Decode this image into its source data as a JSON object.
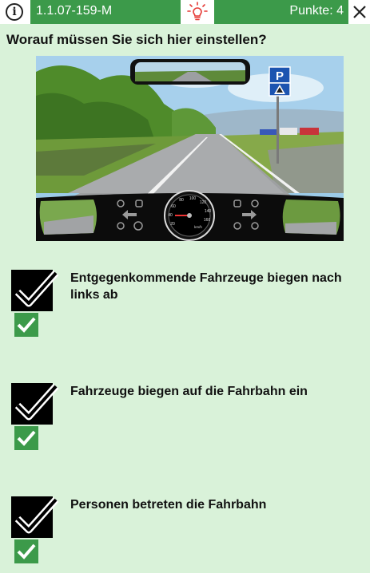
{
  "header": {
    "info_icon": "info-icon",
    "question_id": "1.1.07-159-M",
    "hint_icon": "lightbulb-icon",
    "points": "Punkte: 4",
    "close_icon": "close-icon",
    "colors": {
      "accent": "#3c9a4a",
      "hint_bulb": "#e53935",
      "background": "#d9f2d9"
    }
  },
  "question": {
    "text": "Worauf müssen Sie sich hier einstellen?"
  },
  "scene": {
    "sign_letter": "P",
    "speedometer_unit": "km/h",
    "speedometer_ticks": [
      "20",
      "40",
      "60",
      "80",
      "100",
      "120",
      "140",
      "160"
    ]
  },
  "answers": [
    {
      "text": "Entgegenkommende Fahrzeuge biegen nach links ab",
      "selected": true,
      "correct": true
    },
    {
      "text": "Fahrzeuge biegen auf die Fahrbahn ein",
      "selected": true,
      "correct": true
    },
    {
      "text": "Personen betreten die Fahrbahn",
      "selected": true,
      "correct": true
    }
  ]
}
